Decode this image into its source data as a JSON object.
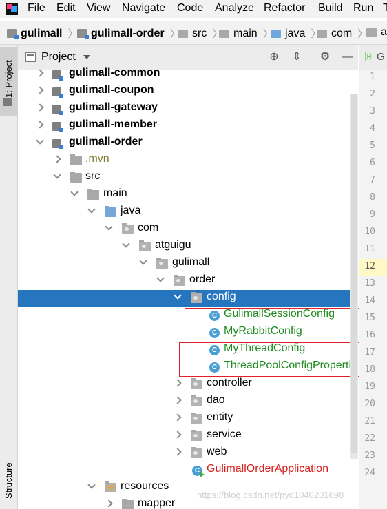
{
  "menu": {
    "items": [
      "File",
      "Edit",
      "View",
      "Navigate",
      "Code",
      "Analyze",
      "Refactor",
      "Build",
      "Run",
      "T"
    ]
  },
  "breadcrumb": {
    "items": [
      "gulimall",
      "gulimall-order",
      "src",
      "main",
      "java",
      "com",
      "at"
    ]
  },
  "tool_window_tabs": {
    "project": "1: Project",
    "structure": "Structure"
  },
  "project_panel": {
    "title": "Project"
  },
  "tree": [
    {
      "label": "gulimall-common",
      "kind": "module",
      "expanded": false
    },
    {
      "label": "gulimall-coupon",
      "kind": "module",
      "expanded": false
    },
    {
      "label": "gulimall-gateway",
      "kind": "module",
      "expanded": false
    },
    {
      "label": "gulimall-member",
      "kind": "module",
      "expanded": false
    },
    {
      "label": "gulimall-order",
      "kind": "module",
      "expanded": true
    },
    {
      "label": ".mvn",
      "kind": "folder",
      "expanded": false
    },
    {
      "label": "src",
      "kind": "folder",
      "expanded": true
    },
    {
      "label": "main",
      "kind": "folder",
      "expanded": true
    },
    {
      "label": "java",
      "kind": "source-folder",
      "expanded": true
    },
    {
      "label": "com",
      "kind": "package",
      "expanded": true
    },
    {
      "label": "atguigu",
      "kind": "package",
      "expanded": true
    },
    {
      "label": "gulimall",
      "kind": "package",
      "expanded": true
    },
    {
      "label": "order",
      "kind": "package",
      "expanded": true
    },
    {
      "label": "config",
      "kind": "package",
      "expanded": true,
      "selected": true
    },
    {
      "label": "GulimallSessionConfig",
      "kind": "class"
    },
    {
      "label": "MyRabbitConfig",
      "kind": "class"
    },
    {
      "label": "MyThreadConfig",
      "kind": "class"
    },
    {
      "label": "ThreadPoolConfigPropertie",
      "kind": "class"
    },
    {
      "label": "controller",
      "kind": "package",
      "expanded": false
    },
    {
      "label": "dao",
      "kind": "package",
      "expanded": false
    },
    {
      "label": "entity",
      "kind": "package",
      "expanded": false
    },
    {
      "label": "service",
      "kind": "package",
      "expanded": false
    },
    {
      "label": "web",
      "kind": "package",
      "expanded": false
    },
    {
      "label": "GulimallOrderApplication",
      "kind": "app-class"
    },
    {
      "label": "resources",
      "kind": "resources",
      "expanded": true
    },
    {
      "label": "mapper",
      "kind": "folder",
      "expanded": false
    }
  ],
  "editor": {
    "tab_label": "G",
    "line_numbers": [
      "1",
      "2",
      "3",
      "4",
      "5",
      "6",
      "7",
      "8",
      "9",
      "10",
      "11",
      "12",
      "13",
      "14",
      "15",
      "16",
      "17",
      "18",
      "19",
      "20",
      "21",
      "22",
      "23",
      "24"
    ],
    "current_line": "12"
  },
  "watermark": "https://blog.csdn.net/pyd1040201698",
  "colors": {
    "selection": "#2675bf",
    "highlight_box": "#e2202a",
    "class_text": "#1f8a1f",
    "app_class_text": "#d92020"
  }
}
